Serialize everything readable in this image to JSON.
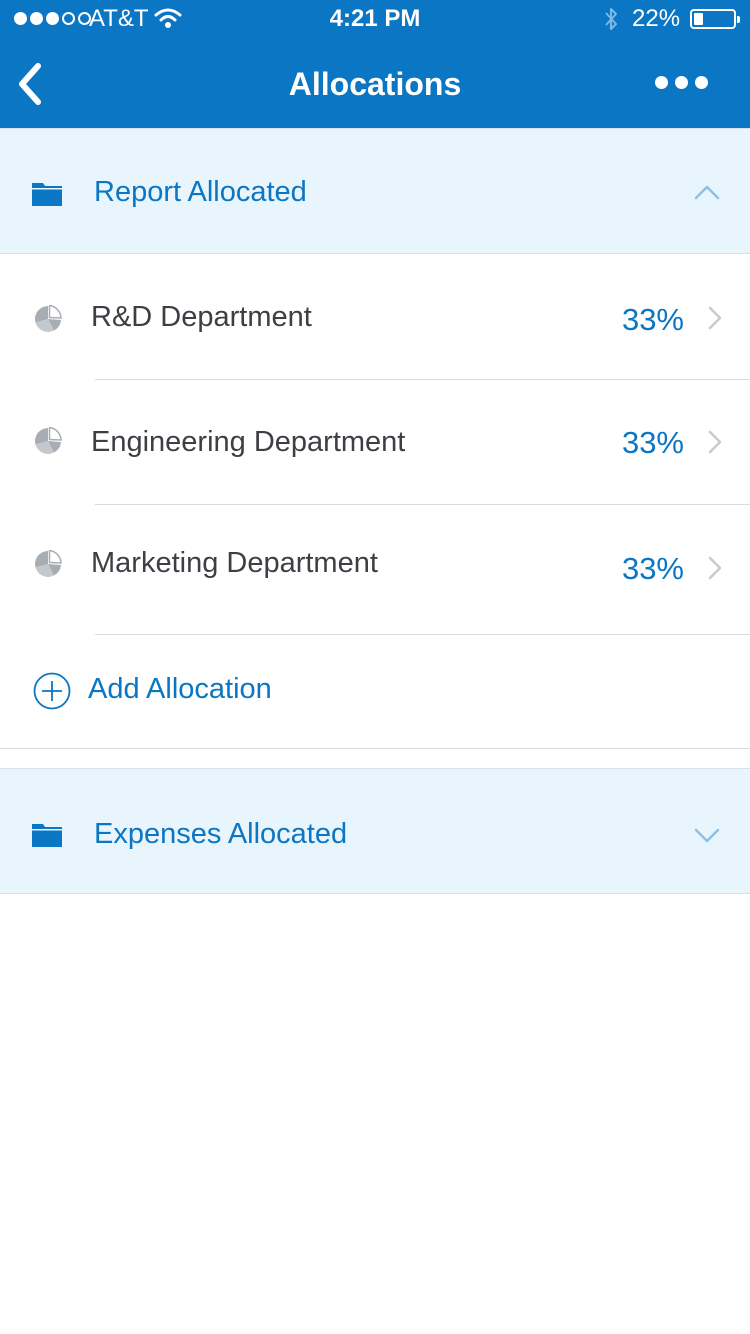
{
  "status_bar": {
    "carrier": "AT&T",
    "time": "4:21 PM",
    "battery_percent": "22%",
    "signal_bars": 3,
    "signal_total": 5,
    "battery_level": 0.22,
    "icons": [
      "signal-dots-icon",
      "wifi-icon",
      "bluetooth-icon",
      "battery-icon"
    ]
  },
  "nav": {
    "title": "Allocations",
    "back_icon": "chevron-left-icon",
    "more_icon": "more-dots-icon"
  },
  "report_section": {
    "label": "Report Allocated",
    "icon": "folder-icon",
    "state": "expanded",
    "toggle_icon": "chevron-up-icon"
  },
  "allocations": [
    {
      "name": "R&D Department",
      "percent": "33%",
      "icon": "pie-chart-icon",
      "arrow_icon": "chevron-right-icon"
    },
    {
      "name": "Engineering Department",
      "percent": "33%",
      "icon": "pie-chart-icon",
      "arrow_icon": "chevron-right-icon"
    },
    {
      "name": "Marketing Department",
      "percent": "33%",
      "icon": "pie-chart-icon",
      "arrow_icon": "chevron-right-icon"
    }
  ],
  "add_allocation": {
    "label": "Add Allocation",
    "icon": "plus-circle-icon"
  },
  "expenses_section": {
    "label": "Expenses Allocated",
    "icon": "folder-icon",
    "state": "collapsed",
    "toggle_icon": "chevron-down-icon"
  },
  "colors": {
    "brand_blue": "#0a76c4",
    "section_bg": "#e9f5fd",
    "text_dark": "#3d3f44",
    "icon_gray": "#a7adb3"
  }
}
